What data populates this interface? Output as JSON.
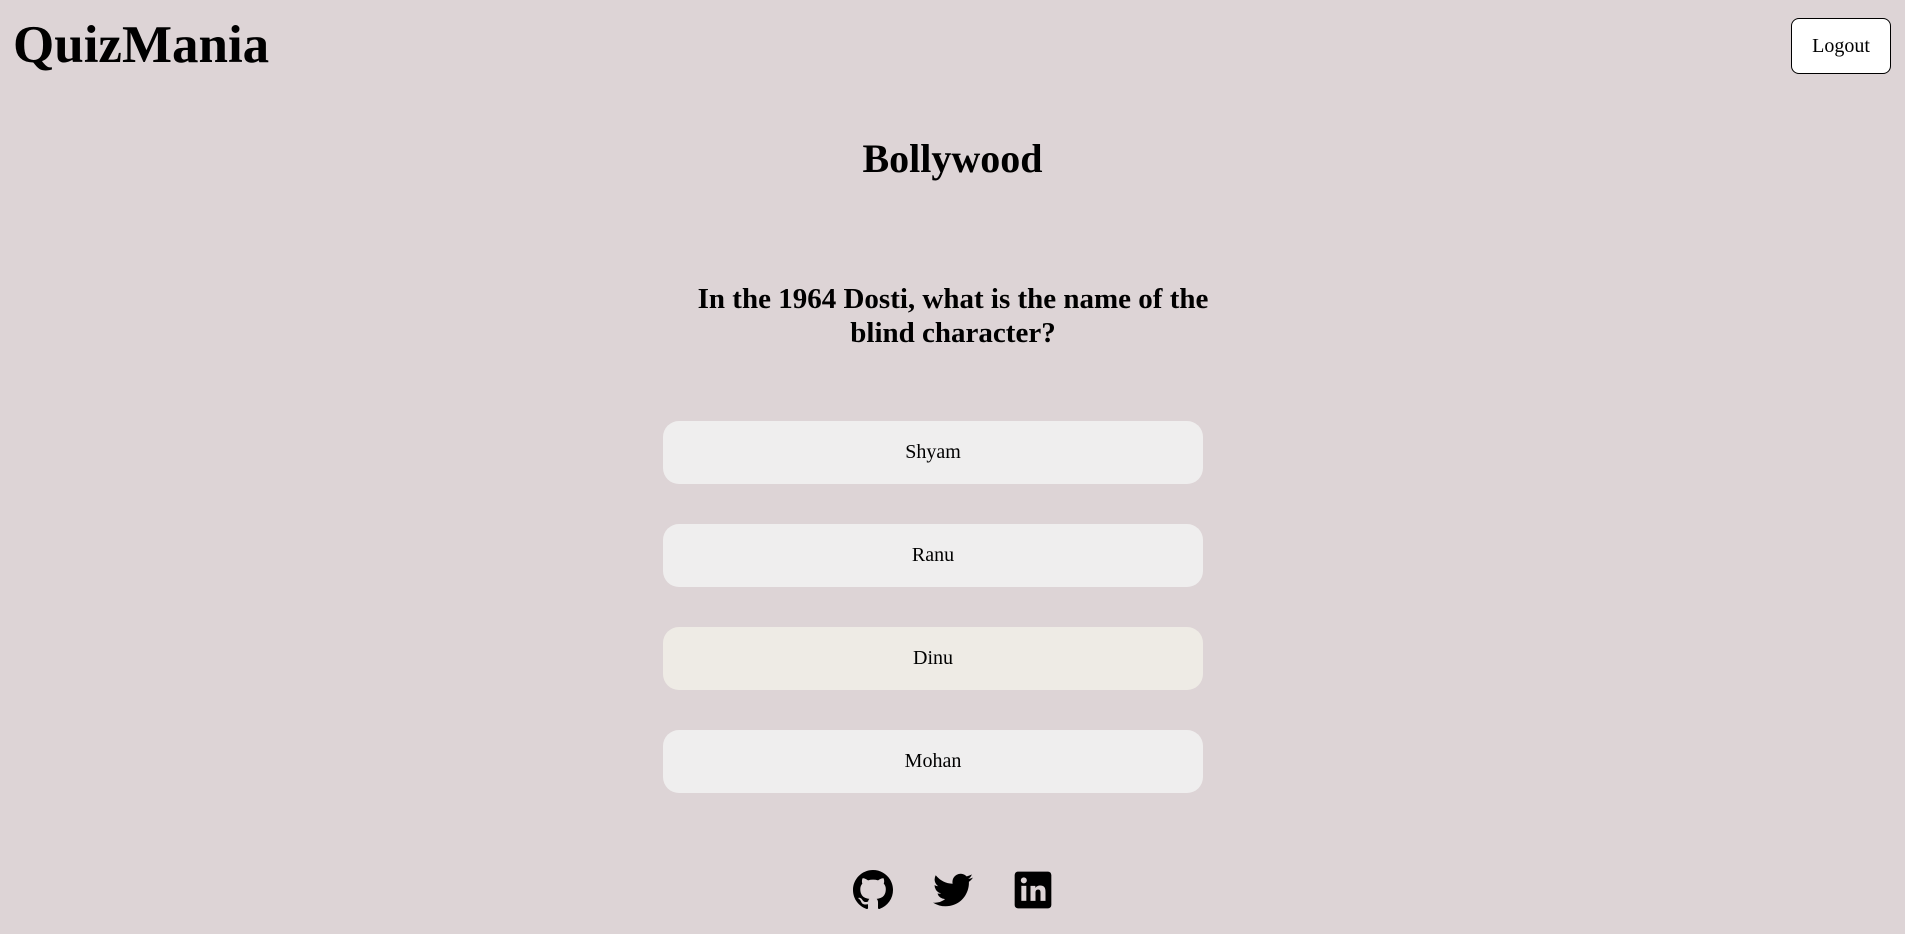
{
  "header": {
    "brand": "QuizMania",
    "logout_label": "Logout"
  },
  "quiz": {
    "category": "Bollywood",
    "question": "In the 1964 Dosti, what is the name of the blind character?",
    "options": [
      {
        "label": "Shyam"
      },
      {
        "label": "Ranu"
      },
      {
        "label": "Dinu",
        "state": "hovered"
      },
      {
        "label": "Mohan"
      }
    ]
  },
  "footer": {
    "socials": [
      {
        "icon": "github-icon"
      },
      {
        "icon": "twitter-icon"
      },
      {
        "icon": "linkedin-icon"
      }
    ]
  },
  "colors": {
    "background": "#ddd4d6",
    "option_bg": "#efeeee",
    "option_hover_bg": "#eeebe5"
  }
}
